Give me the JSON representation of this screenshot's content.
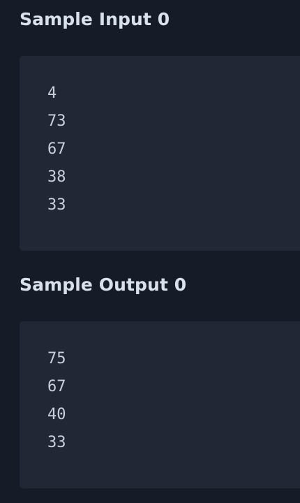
{
  "sample_input": {
    "title": "Sample Input 0",
    "lines": [
      "4",
      "73",
      "67",
      "38",
      "33"
    ]
  },
  "sample_output": {
    "title": "Sample Output 0",
    "lines": [
      "75",
      "67",
      "40",
      "33"
    ]
  },
  "colors": {
    "background": "#161b28",
    "code_background": "#212735",
    "title_text": "#d9e1ec",
    "code_text": "#c9d1dc"
  }
}
